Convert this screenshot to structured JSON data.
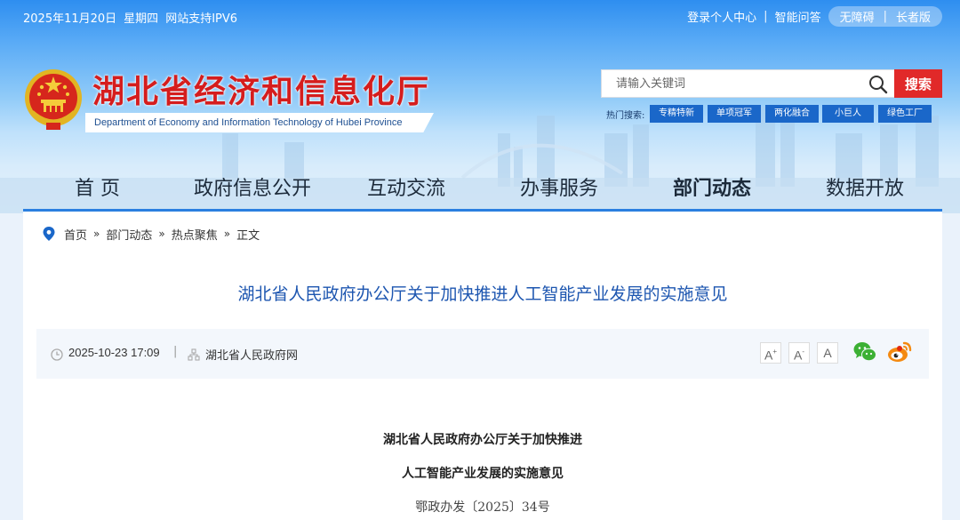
{
  "topbar": {
    "date": "2025年11月20日",
    "weekday": "星期四",
    "ipv6": "网站支持IPV6",
    "login": "登录个人中心",
    "sep": "|",
    "qa": "智能问答",
    "accessible": "无障碍",
    "elder": "长者版"
  },
  "site": {
    "title": "湖北省经济和信息化厅",
    "subtitle_en": "Department of Economy and Information Technology of Hubei Province"
  },
  "search": {
    "placeholder": "请输入关键词",
    "button": "搜索",
    "hot_label": "热门搜索:",
    "hot_tags": [
      "专精特新",
      "单项冠军",
      "两化融合",
      "小巨人",
      "绿色工厂"
    ]
  },
  "nav": {
    "items": [
      "首  页",
      "政府信息公开",
      "互动交流",
      "办事服务",
      "部门动态",
      "数据开放"
    ],
    "active": "部门动态"
  },
  "breadcrumb": {
    "items": [
      "首页",
      "部门动态",
      "热点聚焦",
      "正文"
    ],
    "arrow": "»"
  },
  "article": {
    "title": "湖北省人民政府办公厅关于加快推进人工智能产业发展的实施意见",
    "date": "2025-10-23 17:09",
    "meta_sep": "|",
    "source": "湖北省人民政府网",
    "font_controls": [
      "A",
      "A",
      "A"
    ],
    "font_plus": "+",
    "font_minus": "-",
    "doc_title_line1": "湖北省人民政府办公厅关于加快推进",
    "doc_title_line2": "人工智能产业发展的实施意见",
    "doc_number": "鄂政办发〔2025〕34号"
  },
  "colors": {
    "brand_red": "#d51d1d",
    "brand_blue": "#1a67c9",
    "title_blue": "#1d56b0",
    "search_red": "#e12929"
  },
  "icons": {
    "location": "location-pin-icon",
    "clock": "clock-icon",
    "source": "source-org-icon",
    "wechat": "wechat-icon",
    "weibo": "weibo-icon",
    "search": "search-icon",
    "emblem": "national-emblem-icon"
  }
}
